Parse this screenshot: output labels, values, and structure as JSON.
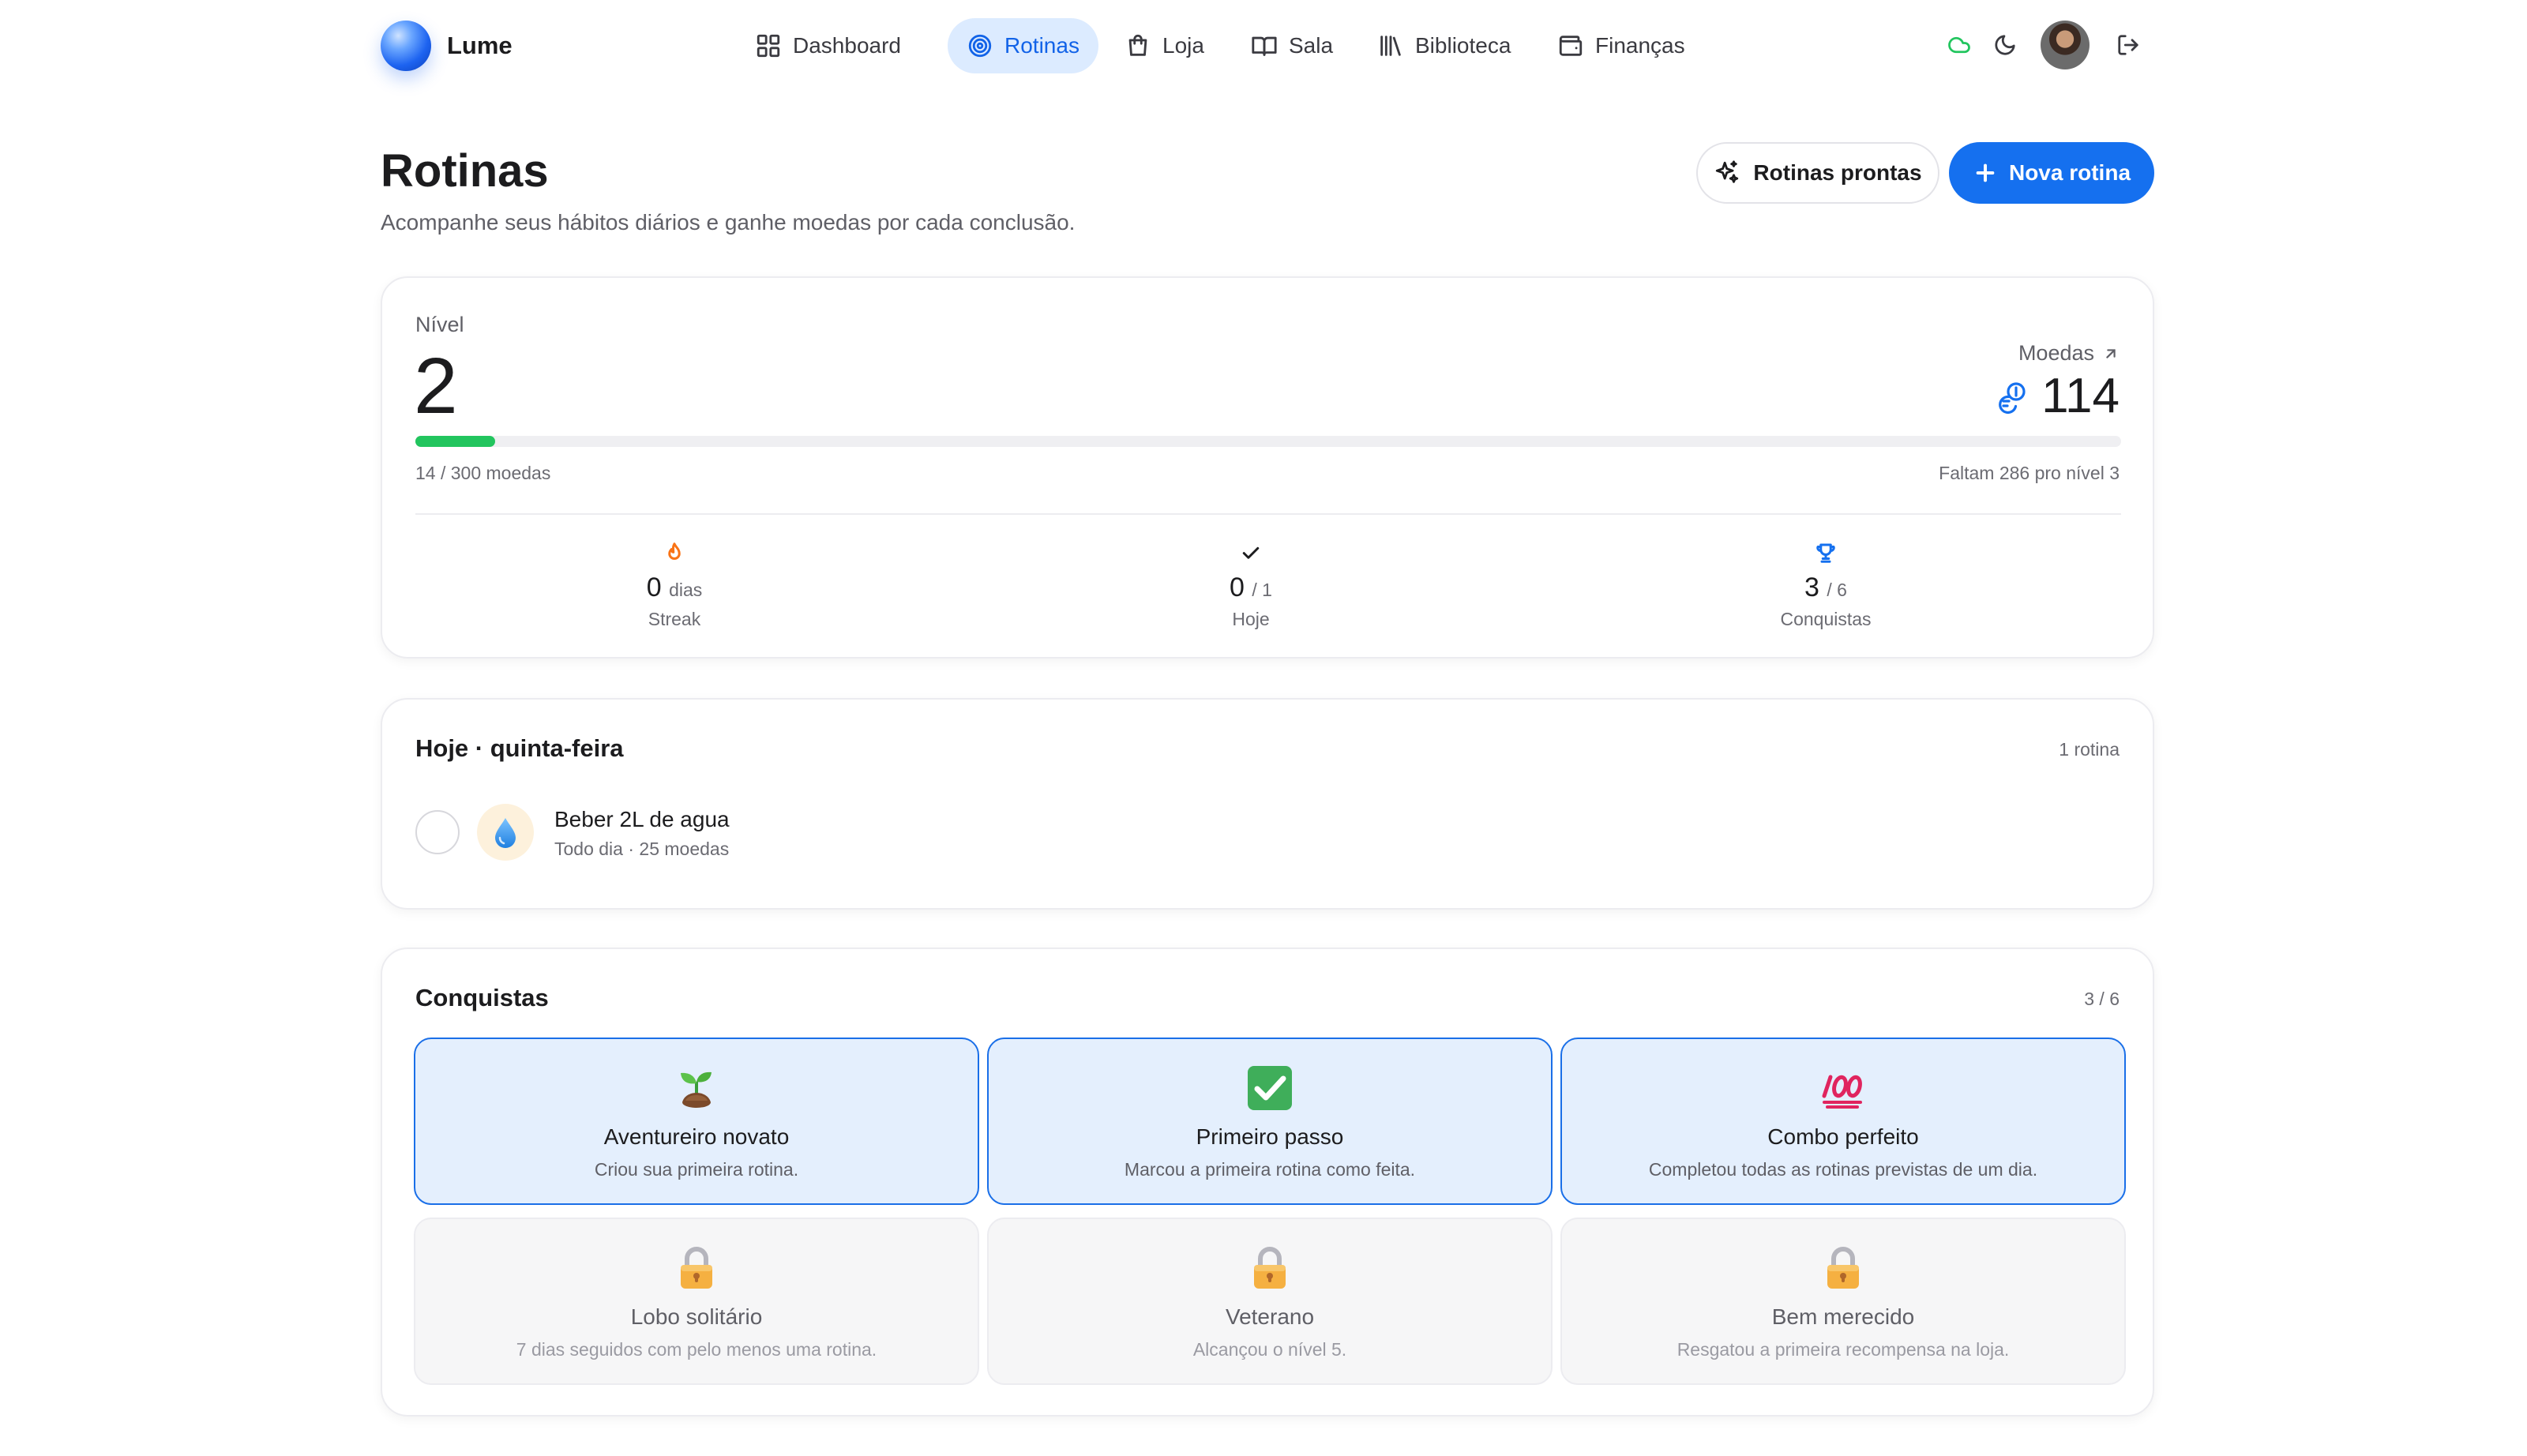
{
  "app": {
    "brand": "Lume"
  },
  "nav": {
    "items": [
      {
        "label": "Dashboard",
        "icon": "grid-icon",
        "active": false
      },
      {
        "label": "Rotinas",
        "icon": "target-icon",
        "active": true
      },
      {
        "label": "Loja",
        "icon": "shopping-bag-icon",
        "active": false
      },
      {
        "label": "Sala",
        "icon": "open-book-icon",
        "active": false
      },
      {
        "label": "Biblioteca",
        "icon": "library-icon",
        "active": false
      },
      {
        "label": "Finanças",
        "icon": "wallet-icon",
        "active": false
      }
    ]
  },
  "header_icons": {
    "cloud": "cloud-icon",
    "theme": "moon-icon",
    "logout": "logout-icon"
  },
  "page": {
    "title": "Rotinas",
    "subtitle": "Acompanhe seus hábitos diários e ganhe moedas por cada conclusão.",
    "btn_ready": "Rotinas prontas",
    "btn_new": "Nova rotina"
  },
  "level_card": {
    "level_label": "Nível",
    "level_value": "2",
    "coins_label": "Moedas",
    "coins_value": "114",
    "progress_fraction": 0.0467,
    "progress_left": "14 / 300 moedas",
    "progress_right": "Faltam 286 pro nível 3",
    "stats": [
      {
        "value": "0",
        "unit": "dias",
        "name": "Streak",
        "icon": "flame-icon"
      },
      {
        "value": "0",
        "unit": "/ 1",
        "name": "Hoje",
        "icon": "check-icon"
      },
      {
        "value": "3",
        "unit": "/ 6",
        "name": "Conquistas",
        "icon": "trophy-icon"
      }
    ]
  },
  "today": {
    "title": "Hoje · quinta-feira",
    "count": "1 rotina",
    "routines": [
      {
        "name": "Beber 2L de agua",
        "meta": "Todo dia · 25 moedas",
        "icon": "water-drop-icon"
      }
    ]
  },
  "achievements": {
    "title": "Conquistas",
    "count": "3 / 6",
    "items": [
      {
        "title": "Aventureiro novato",
        "desc": "Criou sua primeira rotina.",
        "icon": "seedling-icon",
        "unlocked": true
      },
      {
        "title": "Primeiro passo",
        "desc": "Marcou a primeira rotina como feita.",
        "icon": "check-box-icon",
        "unlocked": true
      },
      {
        "title": "Combo perfeito",
        "desc": "Completou todas as rotinas previstas de um dia.",
        "icon": "hundred-points-icon",
        "unlocked": true
      },
      {
        "title": "Lobo solitário",
        "desc": "7 dias seguidos com pelo menos uma rotina.",
        "icon": "lock-icon",
        "unlocked": false
      },
      {
        "title": "Veterano",
        "desc": "Alcançou o nível 5.",
        "icon": "lock-icon",
        "unlocked": false
      },
      {
        "title": "Bem merecido",
        "desc": "Resgatou a primeira recompensa na loja.",
        "icon": "lock-icon",
        "unlocked": false
      }
    ]
  },
  "colors": {
    "accent": "#1570ef",
    "progress": "#22c55e",
    "flame": "#f97316",
    "trophy": "#1570ef",
    "cloud": "#22c55e"
  }
}
